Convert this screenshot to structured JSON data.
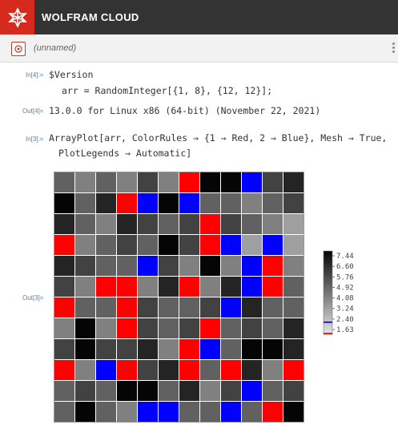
{
  "header": {
    "app_title": "WOLFRAM CLOUD",
    "accent": "#d72a1e",
    "bar_color": "#333333"
  },
  "document": {
    "name": "(unnamed)",
    "icon": "notebook-icon"
  },
  "cells": {
    "in4_label": "In[4]:=",
    "in4_line1": "$Version",
    "in4_line2": "arr = RandomInteger[{1, 8}, {12, 12}];",
    "out4_label": "Out[4]=",
    "out4_text": "13.0.0 for Linux x86 (64-bit) (November 22, 2021)",
    "in3_label": "In[3]:=",
    "in3_line1": "ArrayPlot[arr, ColorRules → {1 → Red, 2 → Blue}, Mesh → True,",
    "in3_line2": "PlotLegends → Automatic]",
    "out3_label": "Out[3]="
  },
  "array_plot": {
    "rows": 12,
    "cols": 12,
    "values": [
      [
        5,
        4,
        5,
        4,
        6,
        4,
        1,
        8,
        8,
        2,
        6,
        7
      ],
      [
        8,
        5,
        7,
        1,
        2,
        8,
        2,
        5,
        5,
        4,
        5,
        6
      ],
      [
        7,
        5,
        4,
        7,
        6,
        5,
        6,
        1,
        6,
        5,
        4,
        3
      ],
      [
        1,
        4,
        5,
        6,
        5,
        8,
        6,
        1,
        2,
        3,
        2,
        3
      ],
      [
        7,
        6,
        5,
        5,
        2,
        6,
        4,
        8,
        4,
        2,
        1,
        4
      ],
      [
        6,
        4,
        1,
        1,
        4,
        7,
        1,
        4,
        7,
        2,
        1,
        5
      ],
      [
        1,
        5,
        5,
        1,
        6,
        5,
        5,
        6,
        2,
        7,
        5,
        5
      ],
      [
        4,
        8,
        4,
        1,
        6,
        5,
        6,
        1,
        5,
        6,
        5,
        7
      ],
      [
        6,
        8,
        6,
        6,
        7,
        4,
        1,
        2,
        5,
        8,
        8,
        7
      ],
      [
        1,
        4,
        2,
        1,
        6,
        7,
        1,
        5,
        1,
        7,
        4,
        1
      ],
      [
        5,
        6,
        5,
        8,
        8,
        5,
        7,
        4,
        6,
        2,
        5,
        6
      ],
      [
        5,
        8,
        5,
        4,
        2,
        2,
        5,
        5,
        2,
        5,
        1,
        8
      ]
    ],
    "color_rules": {
      "1": "#ff0000",
      "2": "#0000ff"
    },
    "mesh": true
  },
  "legend": {
    "ticks": [
      "7.44",
      "6.60",
      "5.76",
      "4.92",
      "4.08",
      "3.24",
      "2.40",
      "1.63"
    ],
    "red_marker_value": 1,
    "blue_marker_value": 2
  }
}
